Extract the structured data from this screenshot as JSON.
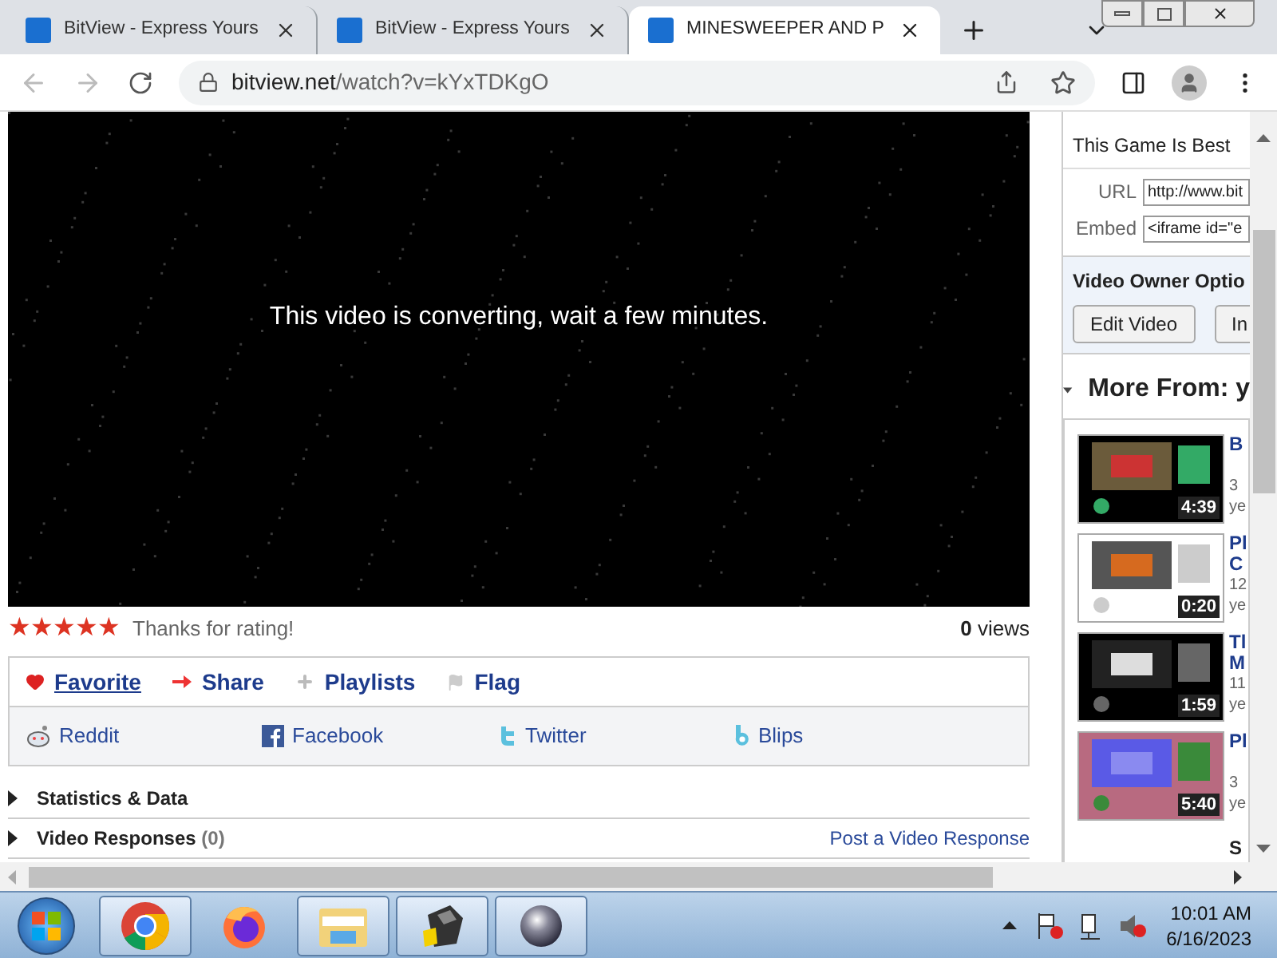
{
  "browser": {
    "tabs": [
      {
        "title": "BitView - Express Yours",
        "selected": false
      },
      {
        "title": "BitView - Express Yours",
        "selected": false
      },
      {
        "title": "MINESWEEPER AND P",
        "selected": true
      }
    ],
    "url_host": "bitview.net",
    "url_path": "/watch?v=kYxTDKgO"
  },
  "video": {
    "message": "This video is converting, wait a few minutes."
  },
  "rating": {
    "stars": 5,
    "text": "Thanks for rating!",
    "views_count": "0",
    "views_label": "views"
  },
  "actions": [
    {
      "kind": "favorite",
      "label": "Favorite",
      "hovered": true
    },
    {
      "kind": "share",
      "label": "Share",
      "hovered": false
    },
    {
      "kind": "playlists",
      "label": "Playlists",
      "hovered": false
    },
    {
      "kind": "flag",
      "label": "Flag",
      "hovered": false
    }
  ],
  "share_links": [
    {
      "kind": "reddit",
      "label": "Reddit"
    },
    {
      "kind": "facebook",
      "label": "Facebook"
    },
    {
      "kind": "twitter",
      "label": "Twitter"
    },
    {
      "kind": "blips",
      "label": "Blips"
    }
  ],
  "sections": [
    {
      "title": "Statistics & Data"
    },
    {
      "title": "Video Responses",
      "count": "(0)",
      "link": "Post a Video Response"
    }
  ],
  "sidebar": {
    "video_title": "This Game Is Best",
    "url_label": "URL",
    "url_value": "http://www.bit",
    "embed_label": "Embed",
    "embed_value": "<iframe id=\"e",
    "owner_title": "Video Owner Optio",
    "owner_buttons": [
      "Edit Video",
      "In"
    ],
    "more_from": "More From: y",
    "related": [
      {
        "duration": "4:39",
        "title": [
          "B"
        ],
        "meta": [
          "3",
          "ye"
        ]
      },
      {
        "duration": "0:20",
        "title": [
          "Pl",
          "C"
        ],
        "meta": [
          "12",
          "ye"
        ]
      },
      {
        "duration": "1:59",
        "title": [
          "Tl",
          "M"
        ],
        "meta": [
          "11",
          "ye"
        ]
      },
      {
        "duration": "5:40",
        "title": [
          "Pl"
        ],
        "meta": [
          "3",
          "ye"
        ]
      }
    ],
    "footer": "S"
  },
  "taskbar": {
    "apps": [
      {
        "kind": "chrome",
        "open": true
      },
      {
        "kind": "firefox",
        "open": false
      },
      {
        "kind": "explorer",
        "open": true
      },
      {
        "kind": "app",
        "open": true
      },
      {
        "kind": "ball",
        "open": true
      }
    ],
    "time": "10:01 AM",
    "date": "6/16/2023"
  }
}
